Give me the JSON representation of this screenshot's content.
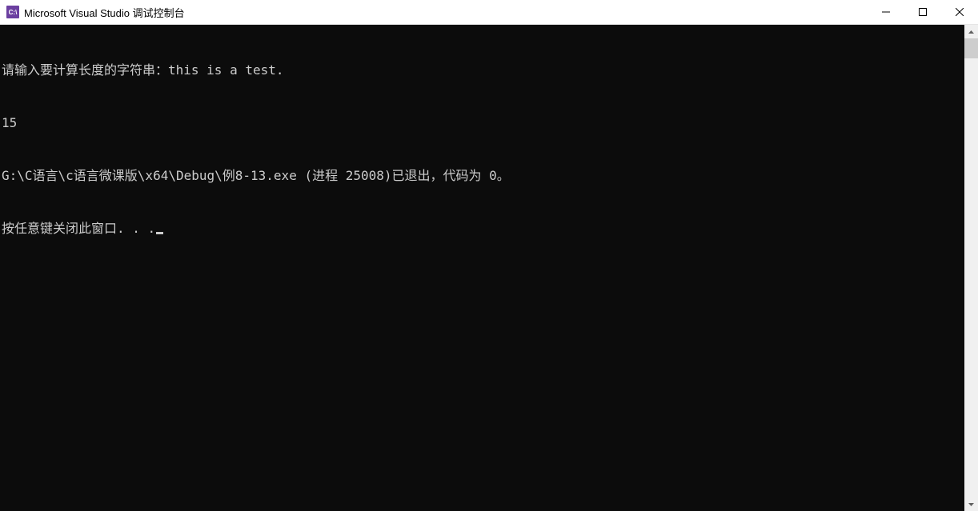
{
  "titlebar": {
    "icon_text": "C:\\",
    "title": "Microsoft Visual Studio 调试控制台"
  },
  "console": {
    "lines": [
      "请输入要计算长度的字符串：this is a test.",
      "15",
      "G:\\C语言\\c语言微课版\\x64\\Debug\\例8-13.exe (进程 25008)已退出，代码为 0。",
      "按任意键关闭此窗口. . ."
    ]
  }
}
